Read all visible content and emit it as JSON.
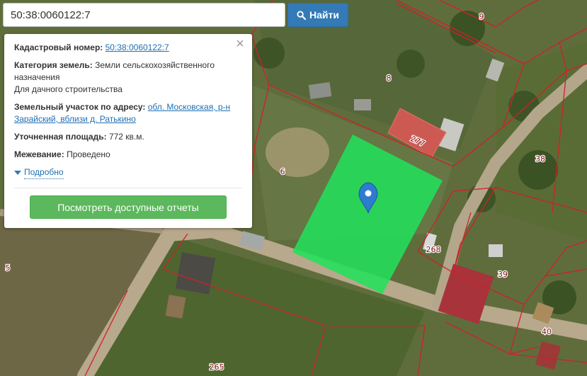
{
  "search": {
    "value": "50:38:0060122:7",
    "button_label": "Найти"
  },
  "info": {
    "cadastral_label": "Кадастровый номер:",
    "cadastral_value": "50:38:0060122:7",
    "category_label": "Категория земель:",
    "category_value": "Земли сельскохозяйственного назначения",
    "purpose": "Для дачного строительства",
    "address_label": "Земельный участок по адресу:",
    "address_value": "обл. Московская, р-н Зарайский, вблизи д. Ратькино",
    "area_label": "Уточненная площадь:",
    "area_value": "772 кв.м.",
    "survey_label": "Межевание:",
    "survey_value": "Проведено",
    "more_label": "Подробно",
    "report_button": "Посмотреть доступные отчеты",
    "close_symbol": "×"
  },
  "map": {
    "parcel_labels": [
      "9",
      "8",
      "277",
      "38",
      "6",
      "268",
      "39",
      "5",
      "40",
      "265"
    ],
    "highlight_color": "#22e05a",
    "boundary_color": "#d0202a",
    "marker_color": "#2e7bcf",
    "marker_icon": "map-pin-icon"
  }
}
